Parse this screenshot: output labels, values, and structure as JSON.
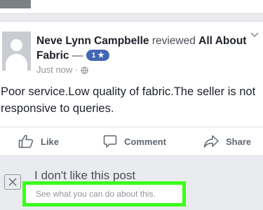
{
  "post": {
    "author": "Neve Lynn Campbelle",
    "verb": "reviewed",
    "page": "All About Fabric",
    "dash": "—",
    "rating": "1 ★",
    "time": "Just now",
    "separator": "·",
    "text": "Poor service.Low quality of fabric.The seller is not responsive to queries."
  },
  "actions": {
    "like": "Like",
    "comment": "Comment",
    "share": "Share"
  },
  "hide_panel": {
    "title": "I don't like this post",
    "subtitle": "See what you can do about this."
  },
  "colors": {
    "highlight": "#3cff1d",
    "rating_badge": "#4267b2"
  }
}
